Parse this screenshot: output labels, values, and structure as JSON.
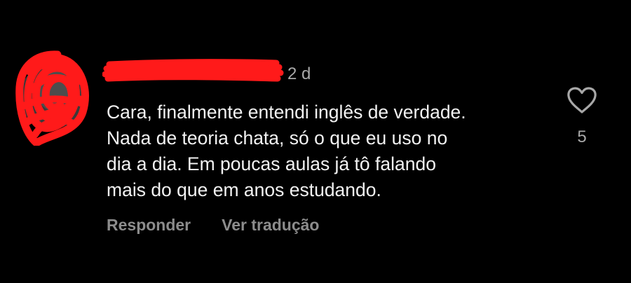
{
  "comment": {
    "timestamp": "2 d",
    "lines": [
      "Cara, finalmente entendi inglês de verdade.",
      "Nada de teoria chata, só o que eu uso no",
      "dia a dia. Em poucas aulas já tô falando",
      "mais do que em anos estudando."
    ],
    "actions": {
      "reply_label": "Responder",
      "translate_label": "Ver tradução"
    },
    "likes": {
      "count": "5",
      "icon": "heart-icon"
    }
  },
  "colors": {
    "background": "#000000",
    "text": "#f2f2f2",
    "muted": "#a8a8a8",
    "redaction": "#ff1a1a"
  }
}
